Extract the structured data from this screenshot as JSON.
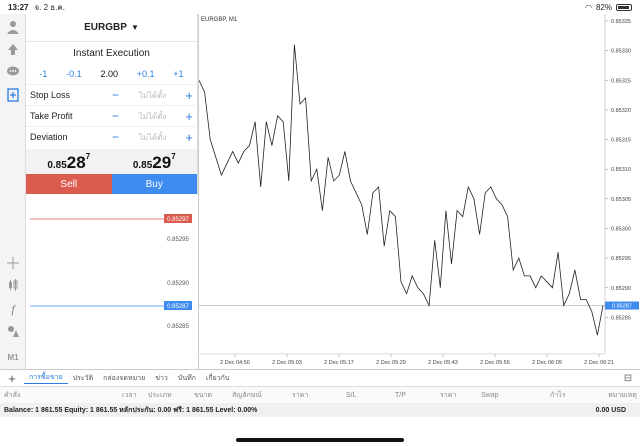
{
  "status": {
    "time": "13:27",
    "date": "จ. 2 ธ.ค.",
    "battery": "82%"
  },
  "order": {
    "symbol": "EURGBP",
    "execution": "Instant Execution",
    "volume": {
      "m1": "-1",
      "m01": "-0.1",
      "value": "2.00",
      "p01": "+0.1",
      "p1": "+1"
    },
    "params": [
      {
        "label": "Stop Loss",
        "placeholder": "ไม่ได้ตั้ง"
      },
      {
        "label": "Take Profit",
        "placeholder": "ไม่ได้ตั้ง"
      },
      {
        "label": "Deviation",
        "placeholder": "ไม่ได้ตั้ง"
      }
    ],
    "sell_price": {
      "small": "0.85",
      "big": "28",
      "sup": "7"
    },
    "buy_price": {
      "small": "0.85",
      "big": "29",
      "sup": "7"
    },
    "sell_label": "Sell",
    "buy_label": "Buy"
  },
  "mini_chart": {
    "ask_tag": "0.85297",
    "bid_tag": "0.85287",
    "levels": [
      "0.85295",
      "0.85290",
      "0.85285"
    ]
  },
  "left_tools": [
    "user-icon",
    "exchange-icon",
    "chat-icon",
    "new-order-icon",
    "crosshair-icon",
    "candles-icon",
    "function-icon",
    "objects-icon"
  ],
  "timeframe": "M1",
  "chart_data": {
    "type": "line",
    "title": "EURGBP, M1",
    "ylim": [
      0.852795,
      0.853355
    ],
    "y_ticks": [
      "0.85335",
      "0.85330",
      "0.85325",
      "0.85320",
      "0.85315",
      "0.85310",
      "0.85305",
      "0.85300",
      "0.85295",
      "0.85290",
      "0.85285"
    ],
    "x_ticks": [
      "2 Dec 04:50",
      "2 Dec 05:03",
      "2 Dec 05:17",
      "2 Dec 05:29",
      "2 Dec 05:43",
      "2 Dec 05:56",
      "2 Dec 06:09",
      "2 Dec 06:21"
    ],
    "bid_line": 0.85287,
    "bid_tag": "0.85287",
    "values": [
      0.85325,
      0.85323,
      0.85315,
      0.85312,
      0.85309,
      0.85311,
      0.85313,
      0.85311,
      0.85313,
      0.85314,
      0.85318,
      0.85307,
      0.85318,
      0.85314,
      0.85319,
      0.85318,
      0.85308,
      0.85331,
      0.85321,
      0.85322,
      0.85308,
      0.8531,
      0.85303,
      0.85312,
      0.85308,
      0.85309,
      0.85313,
      0.85308,
      0.85306,
      0.85304,
      0.85299,
      0.85306,
      0.85307,
      0.85297,
      0.85303,
      0.85302,
      0.85291,
      0.85289,
      0.85292,
      0.8529,
      0.85289,
      0.85287,
      0.85298,
      0.8529,
      0.85303,
      0.85294,
      0.85303,
      0.85302,
      0.85307,
      0.85305,
      0.85299,
      0.85306,
      0.85307,
      0.85305,
      0.85304,
      0.85302,
      0.85293,
      0.85295,
      0.85292,
      0.85292,
      0.8529,
      0.85292,
      0.85291,
      0.8529,
      0.85296,
      0.85287,
      0.85289,
      0.85293,
      0.85288,
      0.85288,
      0.85286,
      0.85282,
      0.85287
    ]
  },
  "tabs": [
    "การซื้อขาย",
    "ประวัติ",
    "กล่องจดหมาย",
    "ข่าว",
    "บันทึก",
    "เกี่ยวกับ"
  ],
  "columns": [
    "คำสั่ง",
    "เวลา",
    "ประเภท",
    "ขนาด",
    "สัญลักษณ์",
    "ราคา",
    "S/L",
    "T/P",
    "ราคา",
    "Swap",
    "กำไร",
    "หมายเหตุ"
  ],
  "balance": {
    "text": "Balance: 1 861.55 Equity: 1 861.55 หลักประกัน: 0.00 ฟรี: 1 861.55 Level: 0.00%",
    "value": "0.00",
    "currency": "USD"
  }
}
